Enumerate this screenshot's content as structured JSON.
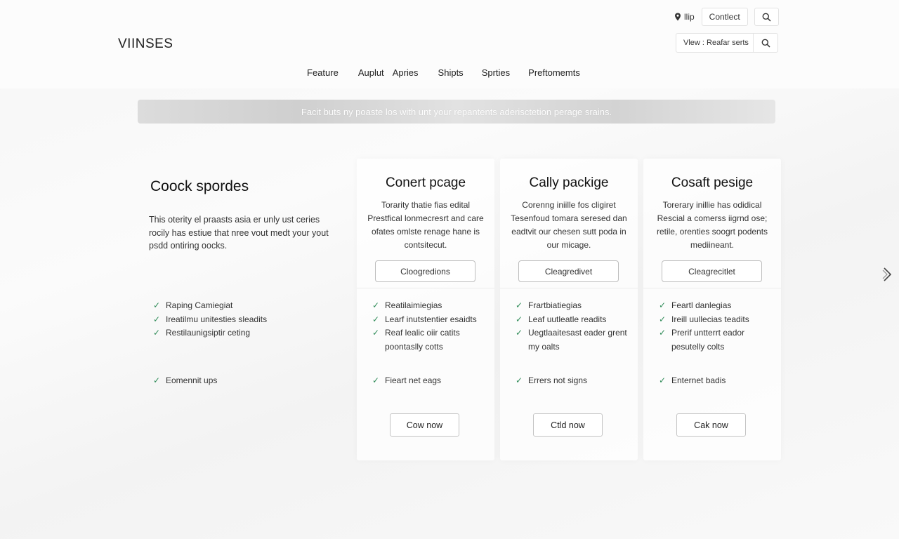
{
  "brand": "VIINSES",
  "top_links": {
    "help": "llip",
    "contact": "Contlect"
  },
  "search": {
    "placeholder": "Vlew : Reafar serts"
  },
  "nav": [
    "Feature",
    "Auplut",
    "Apries",
    "Shipts",
    "Sprties",
    "Preftomemts"
  ],
  "banner": "Facit buts ny poaste los with unt your repantents aderisctetion perage srains.",
  "features": {
    "title": "Coock spordes",
    "desc": "This oterity el praasts asia er unly ust ceries rocily has estiue that nree vout medt your yout psdd ontiring oocks.",
    "items": [
      "Raping Camiegiat",
      "Ireatilmu unitesties sleadits",
      "Restilaunigsiptir ceting"
    ],
    "extra_items": [
      "Eomennit ups"
    ]
  },
  "cards": [
    {
      "title": "Conert pcage",
      "desc": "Torarity thatie fias edital Prestfical lonmecresrt and care ofates omlste renage hane is contsitecut.",
      "primary_button": "Cloogredions",
      "items": [
        "Reatilaimiegias",
        "Learf inutstentier esaidts",
        "Reaf lealic oiir catits poontaslly cotts"
      ],
      "extra_items": [
        "Fieart net eags"
      ],
      "cta": "Cow now"
    },
    {
      "title": "Cally packige",
      "desc": "Corenng iniille fos cligiret Tesenfoud tomara seresed dan eadtvit our chesen sutt poda in our micage.",
      "primary_button": "Cleagredivet",
      "items": [
        "Frartbiatiegias",
        "Leaf uutleatle readits",
        "Uegtlaaitesast eader grent my oalts"
      ],
      "extra_items": [
        "Errers not signs"
      ],
      "cta": "Ctld now"
    },
    {
      "title": "Cosaft pesige",
      "desc": "Torerary inillie has odidical Rescial a comerss iigrnd ose; retile, orenties soogrt podents mediineant.",
      "primary_button": "Cleagrecitlet",
      "items": [
        "Feartl danlegias",
        "Ireill uullecias teadits",
        "Prerif untterrt eador pesutelly colts"
      ],
      "extra_items": [
        "Enternet badis"
      ],
      "cta": "Cak now"
    }
  ],
  "colors": {
    "check": "#2e8b57",
    "banner_text": "#ffffff"
  }
}
